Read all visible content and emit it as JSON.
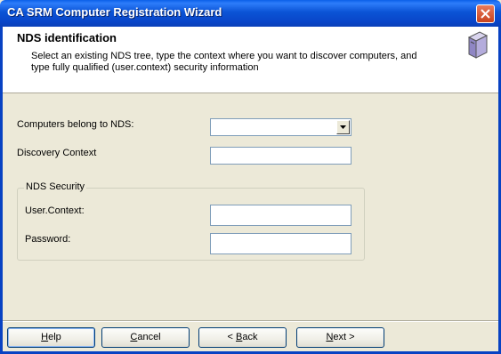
{
  "window": {
    "title": "CA SRM Computer Registration Wizard"
  },
  "header": {
    "title": "NDS identification",
    "description": "Select an existing NDS tree, type the context where you want to discover computers, and type fully qualified (user.context) security information",
    "icon": "server-icon"
  },
  "form": {
    "nds_label": "Computers belong to NDS:",
    "nds_value": "",
    "context_label": "Discovery Context",
    "context_value": ""
  },
  "security": {
    "legend": "NDS Security",
    "user_label": "User.Context:",
    "user_value": "",
    "password_label": "Password:",
    "password_value": ""
  },
  "buttons": {
    "help": {
      "pre": "",
      "key": "H",
      "post": "elp"
    },
    "cancel": {
      "pre": "",
      "key": "C",
      "post": "ancel"
    },
    "back": {
      "pre": "< ",
      "key": "B",
      "post": "ack"
    },
    "next": {
      "pre": "",
      "key": "N",
      "post": "ext >"
    }
  },
  "colors": {
    "titlebar": "#0a54d6",
    "dialog": "#ece9d8",
    "input_border": "#7f9db9"
  }
}
